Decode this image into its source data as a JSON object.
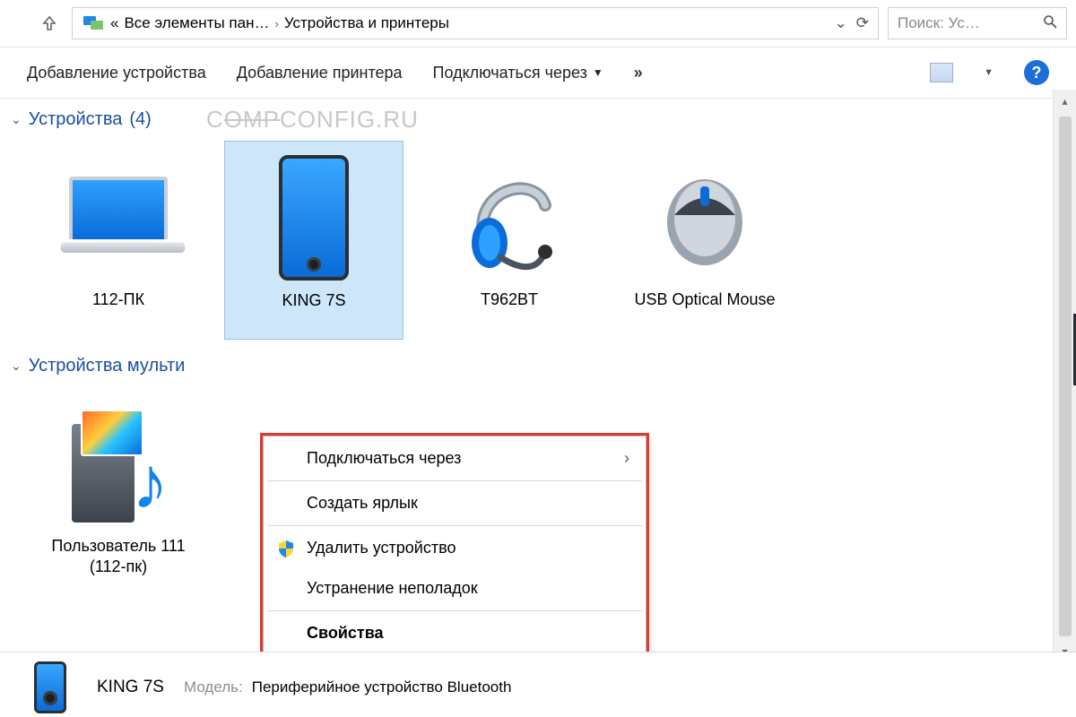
{
  "breadcrumb": {
    "prefix": "«",
    "segment1": "Все элементы пан…",
    "segment2": "Устройства и принтеры"
  },
  "search": {
    "placeholder": "Поиск: Ус…"
  },
  "toolbar": {
    "add_device": "Добавление устройства",
    "add_printer": "Добавление принтера",
    "connect_via": "Подключаться через"
  },
  "groups": {
    "devices": {
      "title": "Устройства",
      "count": "(4)"
    },
    "multimedia": {
      "title": "Устройства мульти"
    }
  },
  "watermark": {
    "a": "C",
    "b": "OMP",
    "c": "CONFIG.RU"
  },
  "devices": [
    {
      "label": "112-ПК"
    },
    {
      "label": "KING 7S"
    },
    {
      "label": "T962BT"
    },
    {
      "label": "USB Optical Mouse"
    }
  ],
  "multimedia": [
    {
      "label": "Пользователь 111 (112-пк)"
    }
  ],
  "context_menu": {
    "connect_via": "Подключаться через",
    "create_shortcut": "Создать ярлык",
    "remove_device": "Удалить устройство",
    "troubleshoot": "Устранение неполадок",
    "properties": "Свойства"
  },
  "details": {
    "name": "KING 7S",
    "model_key": "Модель:",
    "model_value": "Периферийное устройство Bluetooth"
  }
}
